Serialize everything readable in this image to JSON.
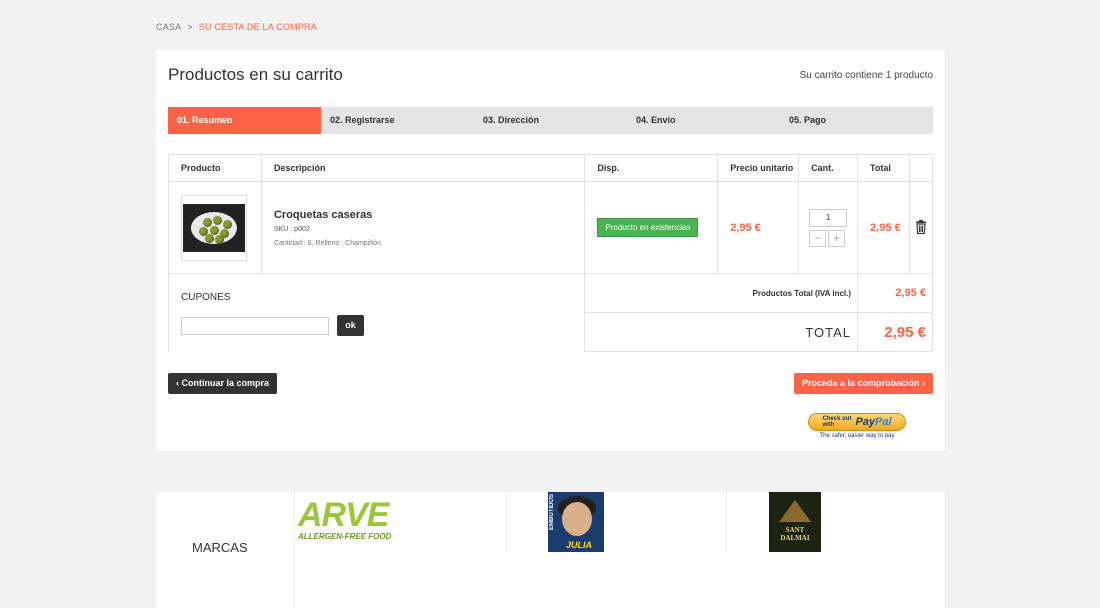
{
  "breadcrumb": {
    "home": "CASA",
    "separator": ">",
    "current": "SU CESTA DE LA COMPRA"
  },
  "header": {
    "title": "Productos en su carrito",
    "cart_count": "Su carrito contiene 1 producto"
  },
  "steps": [
    {
      "label": "01. Resumen",
      "active": true
    },
    {
      "label": "02. Registrarse",
      "active": false
    },
    {
      "label": "03. Dirección",
      "active": false
    },
    {
      "label": "04. Envio",
      "active": false
    },
    {
      "label": "05. Pago",
      "active": false
    }
  ],
  "table": {
    "headers": {
      "product": "Producto",
      "description": "Descripción",
      "availability": "Disp.",
      "unit_price": "Precio unitario",
      "qty": "Cant.",
      "total": "Total"
    },
    "rows": [
      {
        "name": "Croquetas caseras",
        "sku": "SKU : p002",
        "attributes": "Cantidad : 8, Relleno : Champiñón",
        "availability": "Producto en existencias",
        "unit_price": "2,95 €",
        "qty": "1",
        "minus": "−",
        "plus": "+",
        "total": "2,95 €"
      }
    ]
  },
  "coupons": {
    "label": "CUPONES",
    "ok_label": "ok"
  },
  "summary": {
    "products_total_label": "Productos Total (IVA incl.)",
    "products_total_value": "2,95 €",
    "total_label": "TOTAL",
    "total_value": "2,95 €"
  },
  "actions": {
    "continue_label": "Continuar la compra",
    "proceed_label": "Proceda a la comprobación"
  },
  "paypal": {
    "check_line1": "Check out",
    "check_line2": "with",
    "logo_pay": "Pay",
    "logo_pal": "Pal",
    "tagline": "The safer, easier way to pay"
  },
  "brands": {
    "title": "MARCAS",
    "arve": {
      "logo": "ARVE",
      "tagline": "ALLERGEN-FREE FOOD"
    },
    "julia": {
      "vertical": "EMBUTIDOS",
      "name": "JULIA"
    },
    "sant": {
      "line1": "SANT",
      "line2": "DALMAI"
    }
  },
  "colors": {
    "accent": "#ff6347",
    "stock": "#46b450",
    "dark": "#333333"
  }
}
